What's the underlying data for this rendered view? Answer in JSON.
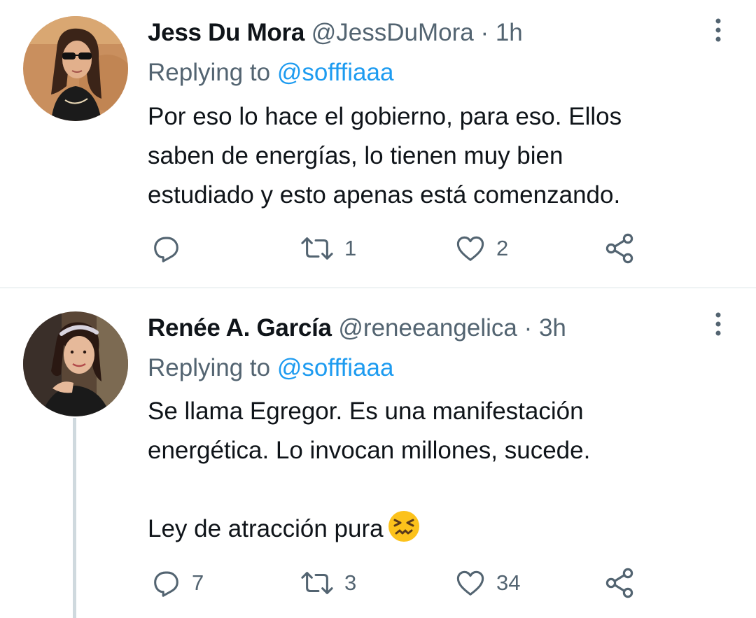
{
  "tweets": [
    {
      "display_name": "Jess Du Mora",
      "handle": "@JessDuMora",
      "separator": "·",
      "time": "1h",
      "replying_prefix": "Replying to ",
      "replying_to": "@sofffiaaa",
      "body_lines": [
        "Por eso lo hace el gobierno, para eso. Ellos",
        "saben de energías, lo tienen muy bien",
        "estudiado y esto apenas está comenzando."
      ],
      "reply_count": "",
      "retweet_count": "1",
      "like_count": "2"
    },
    {
      "display_name": "Renée A. García",
      "handle": "@reneeangelica",
      "separator": "·",
      "time": "3h",
      "replying_prefix": "Replying to ",
      "replying_to": "@sofffiaaa",
      "body_lines": [
        "Se llama Egregor. Es una manifestación",
        "energética. Lo invocan millones, sucede.",
        "",
        "Ley de atracción pura"
      ],
      "emoji": "persevering-face",
      "reply_count": "7",
      "retweet_count": "3",
      "like_count": "34"
    }
  ],
  "icons": {
    "reply": "reply-icon",
    "retweet": "retweet-icon",
    "like": "heart-icon",
    "share": "share-icon",
    "more": "more-icon"
  },
  "colors": {
    "text_primary": "#0f1419",
    "text_secondary": "#536471",
    "accent": "#1d9bf0",
    "divider": "#eff3f4",
    "thread_line": "#cfd9de"
  }
}
